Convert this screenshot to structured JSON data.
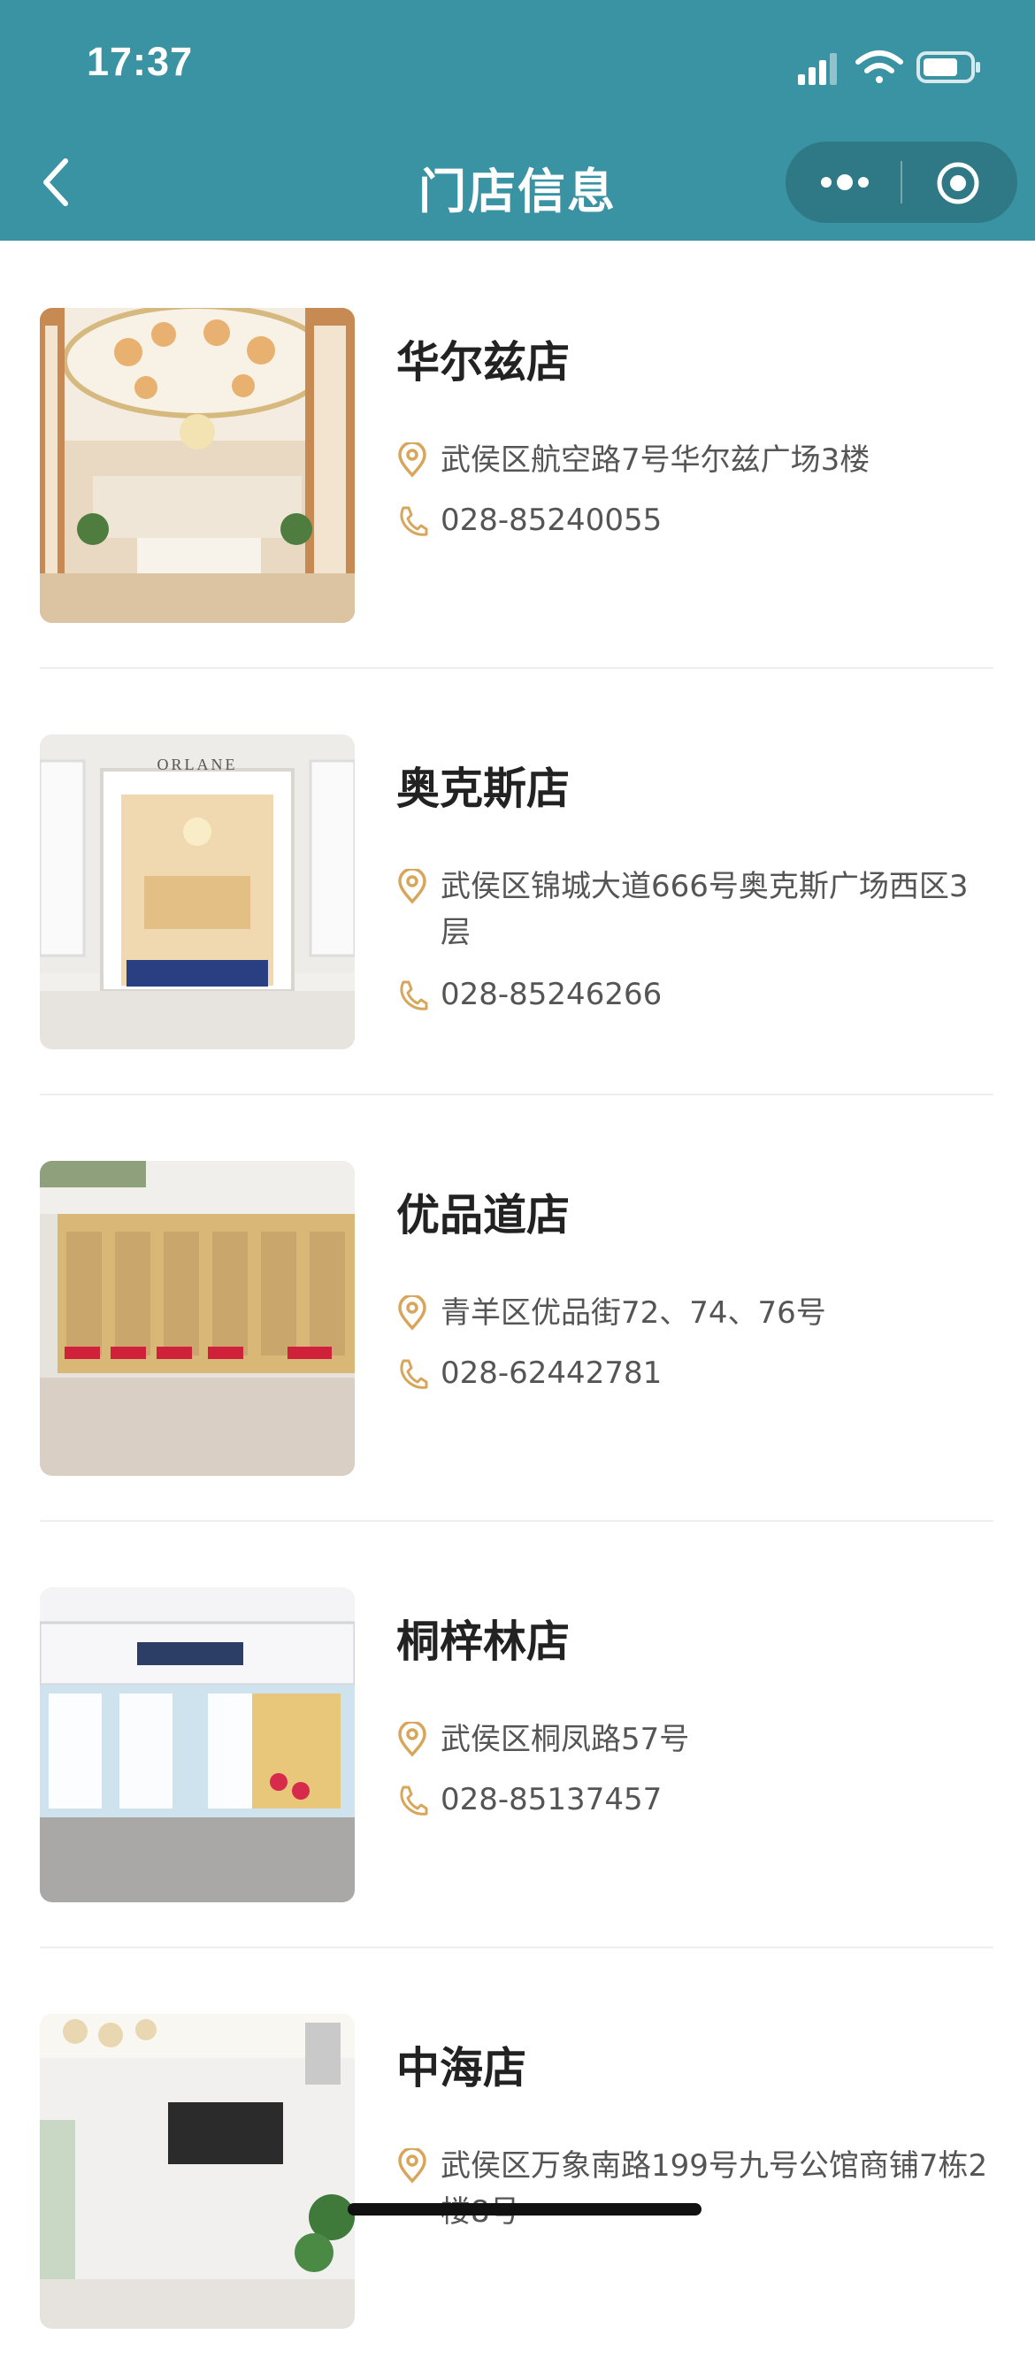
{
  "status_bar": {
    "time": "17:37"
  },
  "nav": {
    "title": "门店信息"
  },
  "stores": [
    {
      "name": "华尔兹店",
      "address": "武侯区航空路7号华尔兹广场3楼",
      "phone": "028-85240055"
    },
    {
      "name": "奥克斯店",
      "address": "武侯区锦城大道666号奥克斯广场西区3层",
      "phone": "028-85246266"
    },
    {
      "name": "优品道店",
      "address": "青羊区优品街72、74、76号",
      "phone": "028-62442781"
    },
    {
      "name": "桐梓林店",
      "address": "武侯区桐凤路57号",
      "phone": "028-85137457"
    },
    {
      "name": "中海店",
      "address": "武侯区万象南路199号九号公馆商铺7栋2楼8号",
      "phone": ""
    }
  ],
  "photo_text": {
    "brand": "ORLANE"
  },
  "colors": {
    "header_bg": "#3a93a3",
    "icon_gold": "#d8a65a",
    "text_dark": "#222222",
    "text_gray": "#555555"
  },
  "icons": [
    "back-arrow",
    "more-dots",
    "target-circle",
    "location-pin",
    "phone"
  ]
}
